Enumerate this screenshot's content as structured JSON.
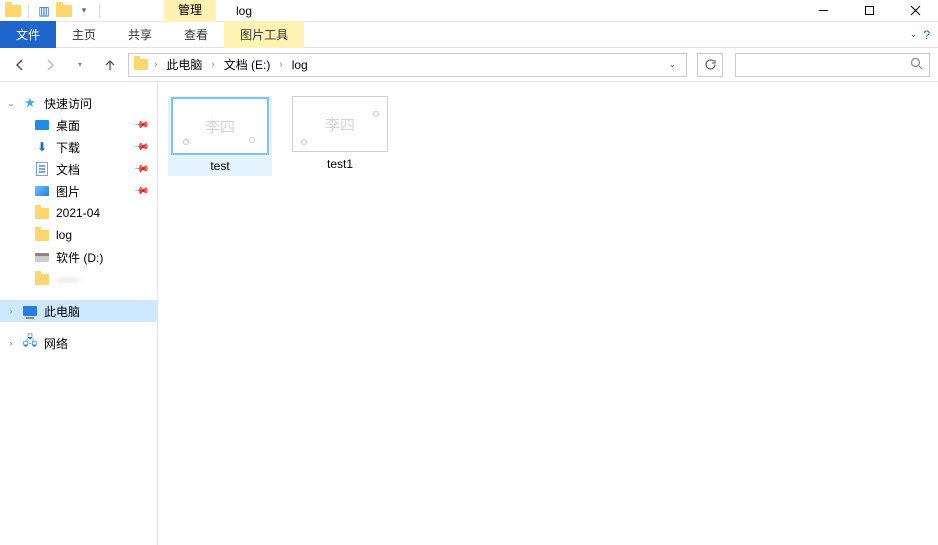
{
  "titlebar": {
    "manage_tab": "管理",
    "window_title": "log",
    "picture_tools": "图片工具"
  },
  "ribbon": {
    "tabs": [
      "文件",
      "主页",
      "共享",
      "查看"
    ],
    "tool_tab": "图片工具"
  },
  "nav": {
    "breadcrumb": [
      "此电脑",
      "文档 (E:)",
      "log"
    ]
  },
  "search": {
    "placeholder": ""
  },
  "sidebar": {
    "quick_access": "快速访问",
    "items": [
      {
        "label": "桌面",
        "pinned": true
      },
      {
        "label": "下载",
        "pinned": true
      },
      {
        "label": "文档",
        "pinned": true
      },
      {
        "label": "图片",
        "pinned": true
      },
      {
        "label": "2021-04",
        "pinned": false
      },
      {
        "label": "log",
        "pinned": false
      },
      {
        "label": "软件 (D:)",
        "pinned": false
      }
    ],
    "obscured_item": "——",
    "this_pc": "此电脑",
    "network": "网络"
  },
  "files": [
    {
      "name": "test",
      "watermark": "李四",
      "selected": true
    },
    {
      "name": "test1",
      "watermark": "李四",
      "selected": false
    }
  ]
}
